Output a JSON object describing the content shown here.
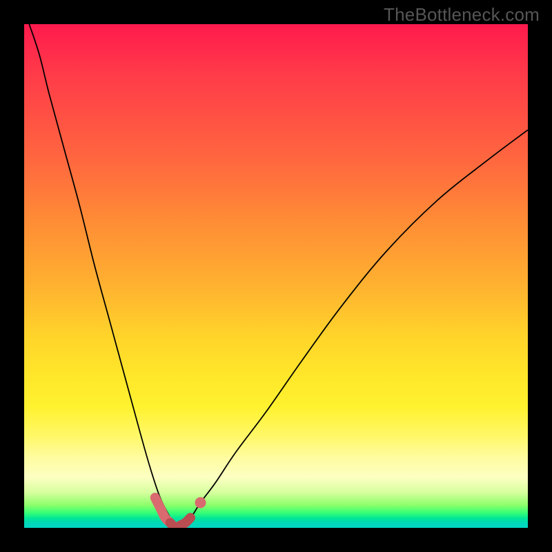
{
  "watermark": "TheBottleneck.com",
  "colors": {
    "background_black": "#000000",
    "gradient_top": "#ff1a4d",
    "gradient_mid": "#ffd42a",
    "gradient_bottom": "#00d5c4",
    "curve_stroke": "#000000",
    "highlight": "#d96a6f",
    "highlight_dark": "#b84d52"
  },
  "chart_data": {
    "type": "line",
    "title": "",
    "subtitle": "",
    "xlabel": "",
    "ylabel": "",
    "xlim": [
      0,
      100
    ],
    "ylim": [
      0,
      100
    ],
    "grid": false,
    "legend": false,
    "annotations": [],
    "notes": "V-shaped bottleneck curve over a vertical heat gradient (red→green). Y reads as percent bottleneck; X reads as component ratio. Minimum (optimal) sits around x≈30 where y≈0. A short salmon/pink highlighted segment and endpoint dots mark the trough.",
    "series": [
      {
        "name": "bottleneck-curve",
        "is_primary": true,
        "x": [
          1,
          3,
          5,
          8,
          11,
          14,
          17,
          20,
          23,
          25,
          27,
          29,
          30,
          31,
          33,
          35,
          38,
          42,
          48,
          55,
          63,
          72,
          82,
          92,
          100
        ],
        "y": [
          100,
          94,
          86,
          75,
          64,
          52,
          41,
          30,
          19,
          12,
          6,
          2,
          0,
          1,
          2,
          5,
          9,
          15,
          23,
          33,
          44,
          55,
          65,
          73,
          79
        ]
      }
    ],
    "highlight_segment": {
      "description": "salmon markers around the curve minimum",
      "x": [
        26,
        27,
        28,
        29,
        30,
        31,
        32,
        33,
        35
      ],
      "y": [
        6,
        4,
        2,
        1,
        0,
        0.5,
        1,
        2,
        5
      ],
      "right_dot": {
        "x": 35,
        "y": 5
      }
    }
  }
}
